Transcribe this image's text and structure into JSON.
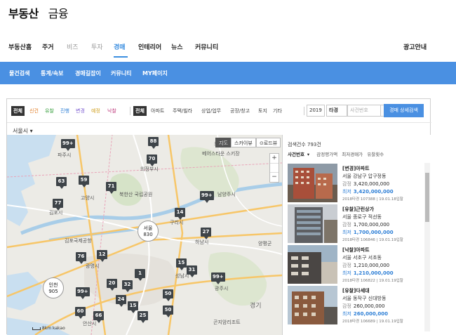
{
  "brand": {
    "main": "부동산",
    "sub": "금융"
  },
  "gnb": {
    "items": [
      "부동산홈",
      "주거",
      "비즈",
      "투자",
      "경매",
      "인테리어",
      "뉴스",
      "커뮤니티"
    ],
    "right": "광고안내"
  },
  "lnb": {
    "items": [
      "물건검색",
      "통계/속보",
      "경매길잡이",
      "커뮤니티",
      "MY페이지"
    ]
  },
  "filter": {
    "kind": [
      "전체",
      "신건",
      "유찰",
      "진행",
      "변경",
      "예정",
      "낙찰"
    ],
    "use": [
      "전체",
      "아파트",
      "주택/빌라",
      "상업/업무",
      "공장/창고",
      "토지",
      "기타"
    ],
    "year": "2019",
    "case_type": "타경",
    "search_placeholder": "사건번호",
    "detail_button": "경매 상세검색"
  },
  "region": "서울시",
  "map": {
    "types": [
      "지도",
      "스카이뷰",
      "로드뷰"
    ],
    "zoom_in": "+",
    "zoom_out": "−",
    "markers": [
      "88",
      "99+",
      "70",
      "63",
      "59",
      "71",
      "99+",
      "77",
      "14",
      "27",
      "76",
      "12",
      "15",
      "31",
      "99+",
      "1",
      "20",
      "32",
      "99+",
      "24",
      "15",
      "50",
      "60",
      "66",
      "25",
      "50"
    ],
    "clusters": [
      {
        "name": "서울",
        "count": "830"
      },
      {
        "name": "인천",
        "count": "905"
      }
    ],
    "places": [
      "파주시",
      "의정부시",
      "고양시",
      "북한산 국립공원",
      "김포시",
      "구리시",
      "하남시",
      "김포국제공항",
      "광명시",
      "성남시",
      "광주시",
      "안산시",
      "포천시",
      "남양주시",
      "양평군",
      "경기",
      "베어스타운 스키장",
      "곤지암리조트"
    ],
    "scale": "8km",
    "provider": "kakao"
  },
  "list": {
    "count_label": "검색건수 793건",
    "sorts": [
      "사건번호",
      "감정평가액",
      "최저경매가",
      "유찰횟수"
    ],
    "items": [
      {
        "title": "[변경]아파트",
        "addr": "서울 강남구 압구정동",
        "appraisal_key": "감정",
        "appraisal": "3,420,000,000",
        "min_key": "최저",
        "min": "3,420,000,000",
        "case": "2018타경 107388",
        "date": "19.01.18입찰"
      },
      {
        "title": "[유찰]근린상가",
        "addr": "서울 종로구 적선동",
        "appraisal_key": "감정",
        "appraisal": "1,700,000,000",
        "min_key": "최저",
        "min": "1,700,000,000",
        "case": "2018타경 106846",
        "date": "19.01.19입찰"
      },
      {
        "title": "[낙찰]아파트",
        "addr": "서울 서초구 서초동",
        "appraisal_key": "감정",
        "appraisal": "1,210,000,000",
        "min_key": "최저",
        "min": "1,210,000,000",
        "case": "2018타경 106822",
        "date": "19.01.19입찰"
      },
      {
        "title": "[유찰]다세대",
        "addr": "서울 동작구 신대방동",
        "appraisal_key": "감정",
        "appraisal": "260,000,000",
        "min_key": "최저",
        "min": "260,000,000",
        "case": "2018타경 106689",
        "date": "19.01.19입찰"
      }
    ]
  },
  "colors": {
    "accent": "#4a90e2",
    "active_tab": "#3d8fe0",
    "marker": "#3e4449",
    "min_price": "#2e7fd6"
  }
}
